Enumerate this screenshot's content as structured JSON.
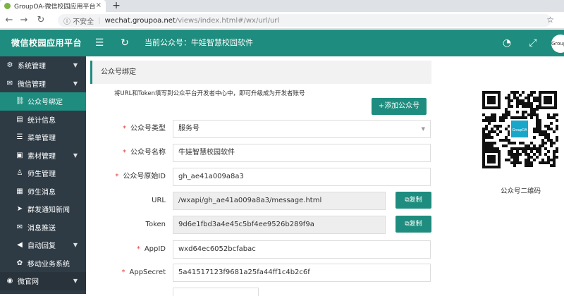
{
  "browser": {
    "tab_title": "GroupOA-微信校园应用平台",
    "tab_close": "×",
    "new_tab": "+",
    "security": "不安全",
    "host": "wechat.groupoa.net",
    "path": "/views/index.html#/wx/url/url"
  },
  "header": {
    "brand": "微信校园应用平台",
    "current_account": "当前公众号：牛娃智慧校园软件",
    "avatar_text": "GroupOA"
  },
  "sidebar": {
    "items": [
      {
        "label": "系统管理",
        "icon": "⚙",
        "level": "top"
      },
      {
        "label": "微信管理",
        "icon": "✉",
        "level": "top"
      },
      {
        "label": "公众号绑定",
        "icon": "⛓",
        "level": "sub",
        "active": true
      },
      {
        "label": "统计信息",
        "icon": "▤",
        "level": "sub"
      },
      {
        "label": "菜单管理",
        "icon": "☰",
        "level": "sub"
      },
      {
        "label": "素材管理",
        "icon": "▣",
        "level": "sub"
      },
      {
        "label": "师生管理",
        "icon": "♙",
        "level": "sub"
      },
      {
        "label": "师生消息",
        "icon": "▦",
        "level": "sub"
      },
      {
        "label": "群发通知新闻",
        "icon": "➤",
        "level": "sub"
      },
      {
        "label": "消息推送",
        "icon": "✉",
        "level": "sub"
      },
      {
        "label": "自动回复",
        "icon": "◀",
        "level": "sub"
      },
      {
        "label": "移动业务系统",
        "icon": "✿",
        "level": "sub"
      },
      {
        "label": "微官网",
        "icon": "◉",
        "level": "top"
      }
    ]
  },
  "panel": {
    "title": "公众号绑定",
    "tip": "将URL和Token填写到公众平台开发者中心中，即可升级成为开发者账号",
    "add_button": "+添加公众号",
    "copy_button": "复制"
  },
  "form": {
    "type_label": "公众号类型",
    "type_value": "服务号",
    "name_label": "公众号名称",
    "name_value": "牛娃智慧校园软件",
    "origid_label": "公众号原始ID",
    "origid_value": "gh_ae41a009a8a3",
    "url_label": "URL",
    "url_value": "/wxapi/gh_ae41a009a8a3/message.html",
    "token_label": "Token",
    "token_value": "9d6e1fbd3a4e45c5bf4ee9526b289f9a",
    "appid_label": "AppID",
    "appid_value": "wxd64ec6052bcfabac",
    "appsecret_label": "AppSecret",
    "appsecret_value": "5a41517123f9681a25fa44ff1c4b2c6f"
  },
  "qr": {
    "label": "公众号二维码",
    "logo_text": "GroupOA"
  },
  "colors": {
    "brand": "#1e8c7e",
    "sidebar": "#2e3b45",
    "required": "#e53935"
  }
}
